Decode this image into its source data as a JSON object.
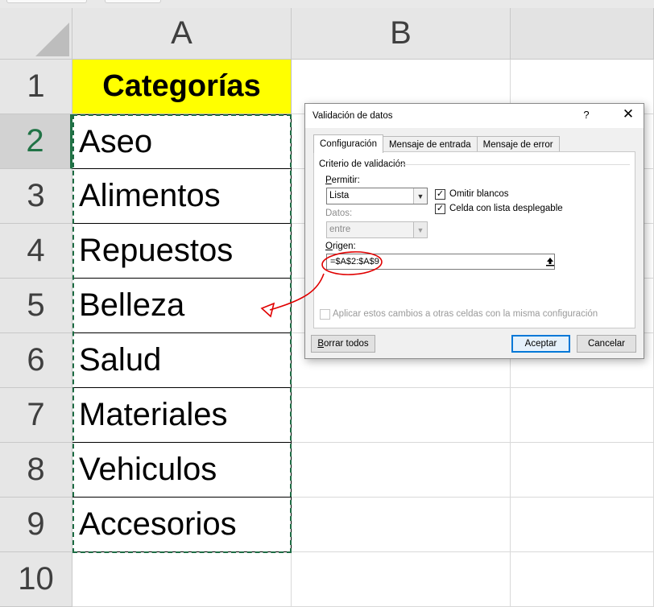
{
  "sheet": {
    "columns": [
      "A",
      "B"
    ],
    "rows": [
      "1",
      "2",
      "3",
      "4",
      "5",
      "6",
      "7",
      "8",
      "9",
      "10"
    ],
    "header_cell": "Categorías",
    "items": [
      "Aseo",
      "Alimentos",
      "Repuestos",
      "Belleza",
      "Salud",
      "Materiales",
      "Vehiculos",
      "Accesorios"
    ],
    "header_fill": "#ffff00",
    "accent": "#217346"
  },
  "dialog": {
    "title": "Validación de datos",
    "help": "?",
    "close": "✕",
    "tabs": [
      "Configuración",
      "Mensaje de entrada",
      "Mensaje de error"
    ],
    "group_label": "Criterio de validación",
    "permitir_label": "Permitir:",
    "permitir_value": "Lista",
    "datos_label": "Datos:",
    "datos_value": "entre",
    "omitir_label": "Omitir blancos",
    "omitir_checked": true,
    "celda_label": "Celda con lista desplegable",
    "celda_checked": true,
    "origen_label": "Origen:",
    "origen_value": "=$A$2:$A$9",
    "aplicar_label": "Aplicar estos cambios a otras celdas con la misma configuración",
    "aplicar_checked": false,
    "clear_button": "Borrar todos",
    "ok_button": "Aceptar",
    "cancel_button": "Cancelar"
  }
}
